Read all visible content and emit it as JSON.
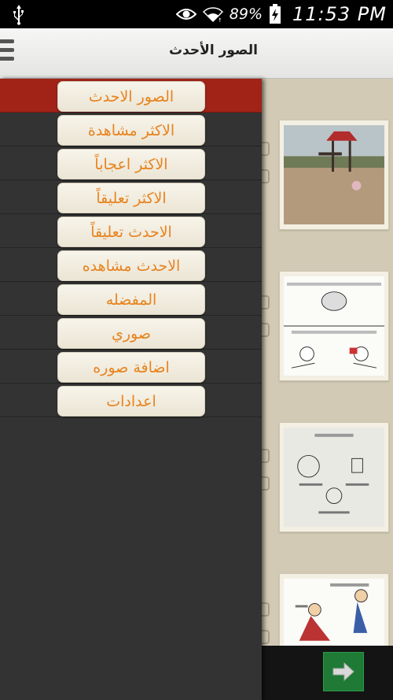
{
  "status_bar": {
    "battery_percent": "89%",
    "time": "11:53 PM",
    "icons": [
      "usb-icon",
      "eye-icon",
      "wifi-icon",
      "battery-charging-icon"
    ]
  },
  "action_bar": {
    "title": "الصور الأحدث",
    "menu_icon": "hamburger-icon"
  },
  "drawer": {
    "active_index": 0,
    "items": [
      {
        "label": "الصور الاحدث"
      },
      {
        "label": "الاكثر مشاهدة"
      },
      {
        "label": "الاكثر اعجاباً"
      },
      {
        "label": "الاكثر تعليقاً"
      },
      {
        "label": "الاحدث تعليقاً"
      },
      {
        "label": "الاحدث مشاهده"
      },
      {
        "label": "المفضله"
      },
      {
        "label": "صوري"
      },
      {
        "label": "اضافة صوره"
      },
      {
        "label": "اعدادات"
      }
    ]
  },
  "feed": {
    "next_button_icon": "arrow-right-icon",
    "colors": {
      "accent": "#e8831e",
      "active_row": "#a12318",
      "drawer_bg": "#333333",
      "next_button": "#1e7a34"
    }
  }
}
